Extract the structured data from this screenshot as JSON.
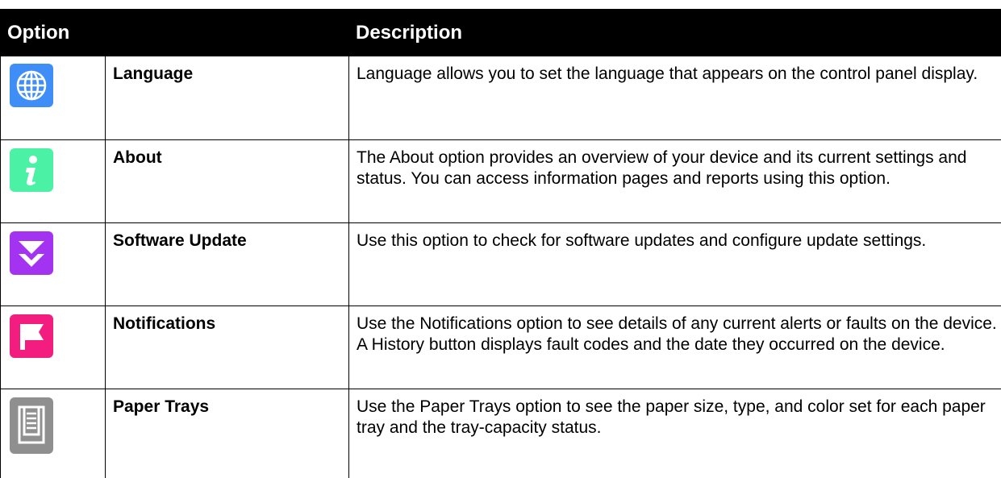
{
  "header": {
    "option": "Option",
    "description": "Description"
  },
  "rows": [
    {
      "name": "Language",
      "icon": "globe-icon",
      "color": "#3f8ef7",
      "description": "Language allows you to set the language that appears on the control panel display."
    },
    {
      "name": "About",
      "icon": "info-icon",
      "color": "#4bf2a5",
      "description": "The About option provides an overview of your device and its current settings and status. You can access information pages and reports using this option."
    },
    {
      "name": "Software Update",
      "icon": "download-chevron-icon",
      "color": "#a433f1",
      "description": "Use this option to check for software updates and configure update settings."
    },
    {
      "name": "Notifications",
      "icon": "flag-icon",
      "color": "#f31c7f",
      "description": "Use the Notifications option to see details of any current alerts or faults on the device. A History button displays fault codes and the date they occurred on the device."
    },
    {
      "name": "Paper Trays",
      "icon": "paper-tray-icon",
      "color": "#8f8f8f",
      "description": "Use the Paper Trays option to see the paper size, type, and color set for each paper tray and the tray-capacity status."
    }
  ]
}
